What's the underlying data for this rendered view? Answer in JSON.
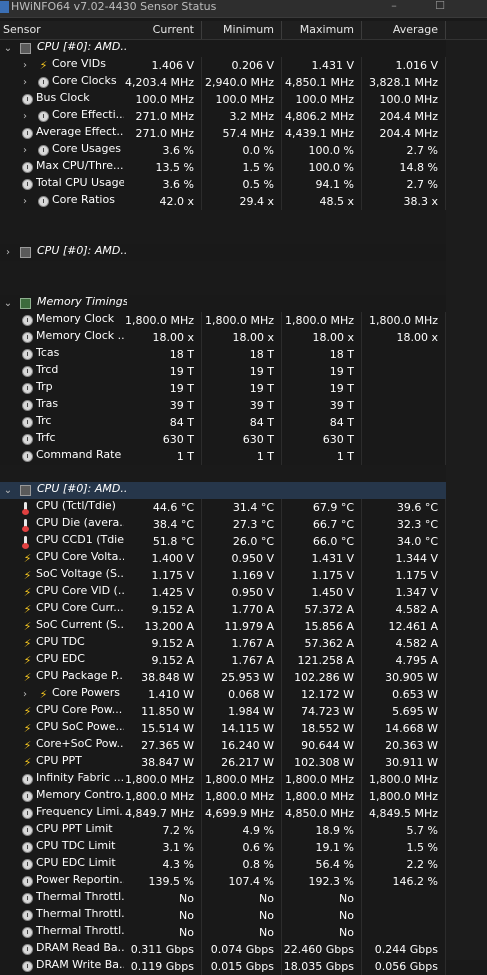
{
  "window": {
    "title": "HWiNFO64 v7.02-4430 Sensor Status"
  },
  "columns": {
    "sensor": "Sensor",
    "current": "Current",
    "minimum": "Minimum",
    "maximum": "Maximum",
    "average": "Average"
  },
  "rows": [
    {
      "type": "group",
      "name": "CPU [#0]: AMD...",
      "icon": "cpu-chip-icon"
    },
    {
      "type": "item",
      "name": "Core VIDs",
      "icon": "bolt-icon",
      "sub": true,
      "cur": "1.406 V",
      "min": "0.206 V",
      "max": "1.431 V",
      "avg": "1.016 V"
    },
    {
      "type": "item",
      "name": "Core Clocks",
      "icon": "clock-icon",
      "sub": true,
      "cur": "4,203.4 MHz",
      "min": "2,940.0 MHz",
      "max": "4,850.1 MHz",
      "avg": "3,828.1 MHz"
    },
    {
      "type": "item",
      "name": "Bus Clock",
      "icon": "clock-icon",
      "cur": "100.0 MHz",
      "min": "100.0 MHz",
      "max": "100.0 MHz",
      "avg": "100.0 MHz"
    },
    {
      "type": "item",
      "name": "Core Effecti...",
      "icon": "clock-icon",
      "sub": true,
      "cur": "271.0 MHz",
      "min": "3.2 MHz",
      "max": "4,806.2 MHz",
      "avg": "204.4 MHz"
    },
    {
      "type": "item",
      "name": "Average Effect...",
      "icon": "clock-icon",
      "cur": "271.0 MHz",
      "min": "57.4 MHz",
      "max": "4,439.1 MHz",
      "avg": "204.4 MHz"
    },
    {
      "type": "item",
      "name": "Core Usages",
      "icon": "clock-icon",
      "sub": true,
      "cur": "3.6 %",
      "min": "0.0 %",
      "max": "100.0 %",
      "avg": "2.7 %"
    },
    {
      "type": "item",
      "name": "Max CPU/Thre...",
      "icon": "clock-icon",
      "cur": "13.5 %",
      "min": "1.5 %",
      "max": "100.0 %",
      "avg": "14.8 %"
    },
    {
      "type": "item",
      "name": "Total CPU Usage",
      "icon": "clock-icon",
      "cur": "3.6 %",
      "min": "0.5 %",
      "max": "94.1 %",
      "avg": "2.7 %"
    },
    {
      "type": "item",
      "name": "Core Ratios",
      "icon": "clock-icon",
      "sub": true,
      "cur": "42.0 x",
      "min": "29.4 x",
      "max": "48.5 x",
      "avg": "38.3 x"
    },
    {
      "type": "sep"
    },
    {
      "type": "sep"
    },
    {
      "type": "group",
      "name": "CPU [#0]: AMD...",
      "icon": "cpu-chip-icon",
      "collapsed": true
    },
    {
      "type": "sep"
    },
    {
      "type": "sep"
    },
    {
      "type": "group",
      "name": "Memory Timings",
      "icon": "memory-icon"
    },
    {
      "type": "item",
      "name": "Memory Clock",
      "icon": "clock-icon",
      "cur": "1,800.0 MHz",
      "min": "1,800.0 MHz",
      "max": "1,800.0 MHz",
      "avg": "1,800.0 MHz"
    },
    {
      "type": "item",
      "name": "Memory Clock ...",
      "icon": "clock-icon",
      "cur": "18.00 x",
      "min": "18.00 x",
      "max": "18.00 x",
      "avg": "18.00 x"
    },
    {
      "type": "item",
      "name": "Tcas",
      "icon": "clock-icon",
      "cur": "18 T",
      "min": "18 T",
      "max": "18 T",
      "avg": ""
    },
    {
      "type": "item",
      "name": "Trcd",
      "icon": "clock-icon",
      "cur": "19 T",
      "min": "19 T",
      "max": "19 T",
      "avg": ""
    },
    {
      "type": "item",
      "name": "Trp",
      "icon": "clock-icon",
      "cur": "19 T",
      "min": "19 T",
      "max": "19 T",
      "avg": ""
    },
    {
      "type": "item",
      "name": "Tras",
      "icon": "clock-icon",
      "cur": "39 T",
      "min": "39 T",
      "max": "39 T",
      "avg": ""
    },
    {
      "type": "item",
      "name": "Trc",
      "icon": "clock-icon",
      "cur": "84 T",
      "min": "84 T",
      "max": "84 T",
      "avg": ""
    },
    {
      "type": "item",
      "name": "Trfc",
      "icon": "clock-icon",
      "cur": "630 T",
      "min": "630 T",
      "max": "630 T",
      "avg": ""
    },
    {
      "type": "item",
      "name": "Command Rate",
      "icon": "clock-icon",
      "cur": "1 T",
      "min": "1 T",
      "max": "1 T",
      "avg": ""
    },
    {
      "type": "sep"
    },
    {
      "type": "group",
      "name": "CPU [#0]: AMD...",
      "icon": "cpu-chip-icon",
      "selected": true
    },
    {
      "type": "item",
      "name": "CPU (Tctl/Tdie)",
      "icon": "thermometer-icon",
      "cur": "44.6 °C",
      "min": "31.4 °C",
      "max": "67.9 °C",
      "avg": "39.6 °C"
    },
    {
      "type": "item",
      "name": "CPU Die (avera...",
      "icon": "thermometer-icon",
      "cur": "38.4 °C",
      "min": "27.3 °C",
      "max": "66.7 °C",
      "avg": "32.3 °C"
    },
    {
      "type": "item",
      "name": "CPU CCD1 (Tdie)",
      "icon": "thermometer-icon",
      "cur": "51.8 °C",
      "min": "26.0 °C",
      "max": "66.0 °C",
      "avg": "34.0 °C"
    },
    {
      "type": "item",
      "name": "CPU Core Volta...",
      "icon": "bolt-icon",
      "cur": "1.400 V",
      "min": "0.950 V",
      "max": "1.431 V",
      "avg": "1.344 V"
    },
    {
      "type": "item",
      "name": "SoC Voltage (S...",
      "icon": "bolt-icon",
      "cur": "1.175 V",
      "min": "1.169 V",
      "max": "1.175 V",
      "avg": "1.175 V"
    },
    {
      "type": "item",
      "name": "CPU Core VID (...",
      "icon": "bolt-icon",
      "cur": "1.425 V",
      "min": "0.950 V",
      "max": "1.450 V",
      "avg": "1.347 V"
    },
    {
      "type": "item",
      "name": "CPU Core Curr...",
      "icon": "bolt-icon",
      "cur": "9.152 A",
      "min": "1.770 A",
      "max": "57.372 A",
      "avg": "4.582 A"
    },
    {
      "type": "item",
      "name": "SoC Current (S...",
      "icon": "bolt-icon",
      "cur": "13.200 A",
      "min": "11.979 A",
      "max": "15.856 A",
      "avg": "12.461 A"
    },
    {
      "type": "item",
      "name": "CPU TDC",
      "icon": "bolt-icon",
      "cur": "9.152 A",
      "min": "1.767 A",
      "max": "57.362 A",
      "avg": "4.582 A"
    },
    {
      "type": "item",
      "name": "CPU EDC",
      "icon": "bolt-icon",
      "cur": "9.152 A",
      "min": "1.767 A",
      "max": "121.258 A",
      "avg": "4.795 A"
    },
    {
      "type": "item",
      "name": "CPU Package P...",
      "icon": "bolt-icon",
      "cur": "38.848 W",
      "min": "25.953 W",
      "max": "102.286 W",
      "avg": "30.905 W"
    },
    {
      "type": "item",
      "name": "Core Powers",
      "icon": "bolt-icon",
      "sub": true,
      "cur": "1.410 W",
      "min": "0.068 W",
      "max": "12.172 W",
      "avg": "0.653 W"
    },
    {
      "type": "item",
      "name": "CPU Core Pow...",
      "icon": "bolt-icon",
      "cur": "11.850 W",
      "min": "1.984 W",
      "max": "74.723 W",
      "avg": "5.695 W"
    },
    {
      "type": "item",
      "name": "CPU SoC Powe...",
      "icon": "bolt-icon",
      "cur": "15.514 W",
      "min": "14.115 W",
      "max": "18.552 W",
      "avg": "14.668 W"
    },
    {
      "type": "item",
      "name": "Core+SoC Pow...",
      "icon": "bolt-icon",
      "cur": "27.365 W",
      "min": "16.240 W",
      "max": "90.644 W",
      "avg": "20.363 W"
    },
    {
      "type": "item",
      "name": "CPU PPT",
      "icon": "bolt-icon",
      "cur": "38.847 W",
      "min": "26.217 W",
      "max": "102.308 W",
      "avg": "30.911 W"
    },
    {
      "type": "item",
      "name": "Infinity Fabric ...",
      "icon": "clock-icon",
      "cur": "1,800.0 MHz",
      "min": "1,800.0 MHz",
      "max": "1,800.0 MHz",
      "avg": "1,800.0 MHz"
    },
    {
      "type": "item",
      "name": "Memory Contro...",
      "icon": "clock-icon",
      "cur": "1,800.0 MHz",
      "min": "1,800.0 MHz",
      "max": "1,800.0 MHz",
      "avg": "1,800.0 MHz"
    },
    {
      "type": "item",
      "name": "Frequency Limi...",
      "icon": "clock-icon",
      "cur": "4,849.7 MHz",
      "min": "4,699.9 MHz",
      "max": "4,850.0 MHz",
      "avg": "4,849.5 MHz"
    },
    {
      "type": "item",
      "name": "CPU PPT Limit",
      "icon": "clock-icon",
      "cur": "7.2 %",
      "min": "4.9 %",
      "max": "18.9 %",
      "avg": "5.7 %"
    },
    {
      "type": "item",
      "name": "CPU TDC Limit",
      "icon": "clock-icon",
      "cur": "3.1 %",
      "min": "0.6 %",
      "max": "19.1 %",
      "avg": "1.5 %"
    },
    {
      "type": "item",
      "name": "CPU EDC Limit",
      "icon": "clock-icon",
      "cur": "4.3 %",
      "min": "0.8 %",
      "max": "56.4 %",
      "avg": "2.2 %"
    },
    {
      "type": "item",
      "name": "Power Reportin...",
      "icon": "clock-icon",
      "cur": "139.5 %",
      "min": "107.4 %",
      "max": "192.3 %",
      "avg": "146.2 %"
    },
    {
      "type": "item",
      "name": "Thermal Throttl...",
      "icon": "clock-icon",
      "cur": "No",
      "min": "No",
      "max": "No",
      "avg": ""
    },
    {
      "type": "item",
      "name": "Thermal Throttl...",
      "icon": "clock-icon",
      "cur": "No",
      "min": "No",
      "max": "No",
      "avg": ""
    },
    {
      "type": "item",
      "name": "Thermal Throttl...",
      "icon": "clock-icon",
      "cur": "No",
      "min": "No",
      "max": "No",
      "avg": ""
    },
    {
      "type": "item",
      "name": "DRAM Read Ba...",
      "icon": "clock-icon",
      "cur": "0.311 Gbps",
      "min": "0.074 Gbps",
      "max": "22.460 Gbps",
      "avg": "0.244 Gbps"
    },
    {
      "type": "item",
      "name": "DRAM Write Ba...",
      "icon": "clock-icon",
      "cur": "0.119 Gbps",
      "min": "0.015 Gbps",
      "max": "18.035 Gbps",
      "avg": "0.056 Gbps"
    }
  ]
}
